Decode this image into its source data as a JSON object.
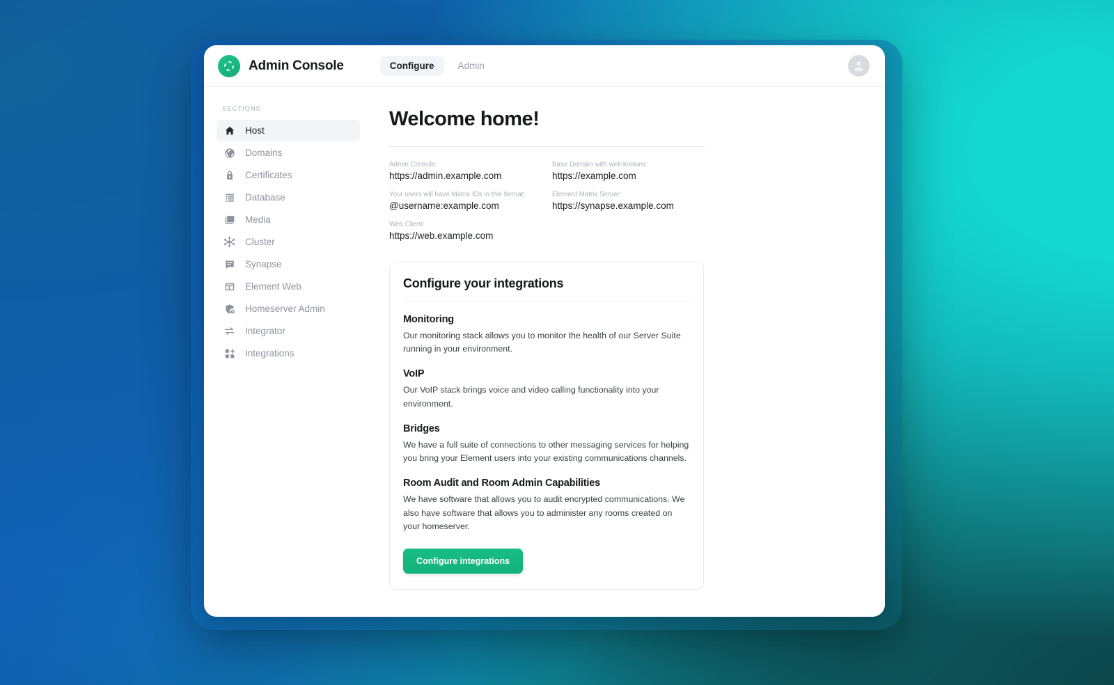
{
  "app": {
    "brand_title": "Admin Console",
    "logo_icon": "element-refresh-logo-icon",
    "avatar_icon": "user-avatar-icon"
  },
  "topnav": {
    "tabs": [
      {
        "label": "Configure",
        "active": true
      },
      {
        "label": "Admin",
        "active": false
      }
    ]
  },
  "sidebar": {
    "heading": "SECTIONS",
    "items": [
      {
        "label": "Host",
        "icon": "home-icon",
        "active": true
      },
      {
        "label": "Domains",
        "icon": "globe-icon",
        "active": false
      },
      {
        "label": "Certificates",
        "icon": "lock-icon",
        "active": false
      },
      {
        "label": "Database",
        "icon": "list-icon",
        "active": false
      },
      {
        "label": "Media",
        "icon": "photo-icon",
        "active": false
      },
      {
        "label": "Cluster",
        "icon": "cluster-nodes-icon",
        "active": false
      },
      {
        "label": "Synapse",
        "icon": "chat-bubble-icon",
        "active": false
      },
      {
        "label": "Element Web",
        "icon": "browser-window-icon",
        "active": false
      },
      {
        "label": "Homeserver Admin",
        "icon": "shield-gear-icon",
        "active": false
      },
      {
        "label": "Integrator",
        "icon": "arrows-exchange-icon",
        "active": false
      },
      {
        "label": "Integrations",
        "icon": "grid-blocks-icon",
        "active": false
      }
    ]
  },
  "main": {
    "page_title": "Welcome home!",
    "info_fields": [
      {
        "label": "Admin Console:",
        "value": "https://admin.example.com"
      },
      {
        "label": "Base Domain with well-knowns:",
        "value": "https://example.com"
      },
      {
        "label": "Your users will have Matrix IDs in this format:",
        "value": "@username:example.com"
      },
      {
        "label": "Element Matrix Server:",
        "value": "https://synapse.example.com"
      },
      {
        "label": "Web Client:",
        "value": "https://web.example.com"
      }
    ],
    "integrations_card": {
      "title": "Configure your integrations",
      "features": [
        {
          "title": "Monitoring",
          "description": "Our monitoring stack allows you to monitor the health of our Server Suite running in your environment."
        },
        {
          "title": "VoIP",
          "description": "Our VoIP stack brings voice and video calling functionality into your environment."
        },
        {
          "title": "Bridges",
          "description": "We have a full suite of connections to other messaging services for helping you bring your Element users into your existing communications channels."
        },
        {
          "title": "Room Audit and Room Admin Capabilities",
          "description": "We have software that allows you to audit encrypted communications. We also have software that allows you to administer any rooms created on your homeserver."
        }
      ],
      "button_label": "Configure integrations"
    }
  },
  "colors": {
    "brand_green": "#16b981",
    "background_blue": "#1160b0",
    "background_teal": "#14d8d0",
    "active_item_bg": "#f2f4f7"
  }
}
